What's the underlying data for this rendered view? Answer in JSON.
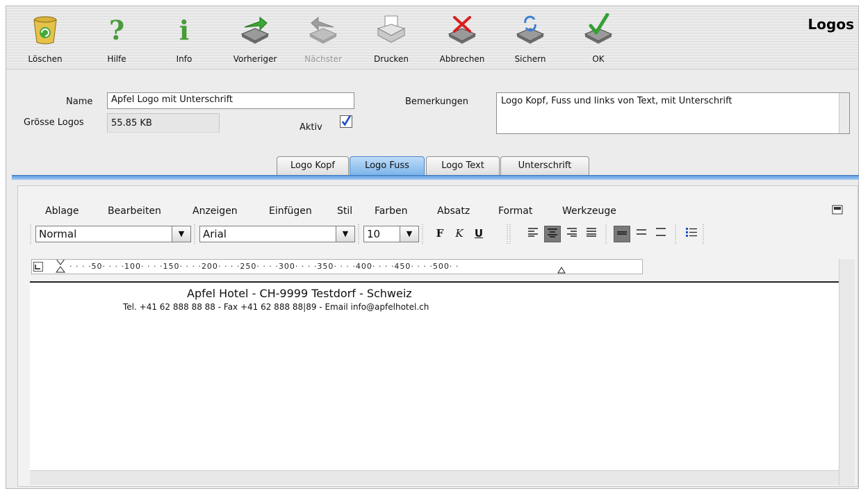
{
  "window": {
    "title": "Logos"
  },
  "toolbar": {
    "buttons": [
      {
        "label": "Löschen",
        "icon": "trash-icon"
      },
      {
        "label": "Hilfe",
        "icon": "help-question-icon"
      },
      {
        "label": "Info",
        "icon": "info-icon"
      },
      {
        "label": "Vorheriger",
        "icon": "previous-record-icon"
      },
      {
        "label": "Nächster",
        "icon": "next-record-icon",
        "disabled": true
      },
      {
        "label": "Drucken",
        "icon": "printer-icon"
      },
      {
        "label": "Abbrechen",
        "icon": "cancel-icon"
      },
      {
        "label": "Sichern",
        "icon": "save-icon"
      },
      {
        "label": "OK",
        "icon": "ok-check-icon"
      }
    ]
  },
  "form": {
    "name_label": "Name",
    "name_value": "Apfel Logo mit Unterschrift",
    "size_label": "Grösse Logos",
    "size_value": "55.85 KB",
    "aktiv_label": "Aktiv",
    "aktiv_checked": true,
    "bemerkungen_label": "Bemerkungen",
    "bemerkungen_value": "Logo Kopf, Fuss und links von Text, mit Unterschrift"
  },
  "tabs": [
    {
      "label": "Logo Kopf",
      "active": false
    },
    {
      "label": "Logo Fuss",
      "active": true
    },
    {
      "label": "Logo Text",
      "active": false
    },
    {
      "label": "Unterschrift",
      "active": false
    }
  ],
  "editor": {
    "menu": [
      "Ablage",
      "Bearbeiten",
      "Anzeigen",
      "Einfügen",
      "Stil",
      "Farben",
      "Absatz",
      "Format",
      "Werkzeuge"
    ],
    "style_value": "Normal",
    "font_value": "Arial",
    "size_value": "10",
    "bold_label": "F",
    "italic_label": "K",
    "underline_label": "U",
    "ruler_labels": [
      "50",
      "100",
      "150",
      "200",
      "250",
      "300",
      "350",
      "400",
      "450",
      "500"
    ],
    "document_lines": [
      "Apfel Hotel - CH-9999 Testdorf - Schweiz",
      "Tel. +41 62 888 88 88 - Fax +41 62 888 88|89 - Email info@apfelhotel.ch"
    ]
  },
  "colors": {
    "tab_active": "#79b4ea",
    "check_blue": "#1e50c8",
    "cancel_red": "#d62020",
    "ok_green": "#33a033"
  }
}
